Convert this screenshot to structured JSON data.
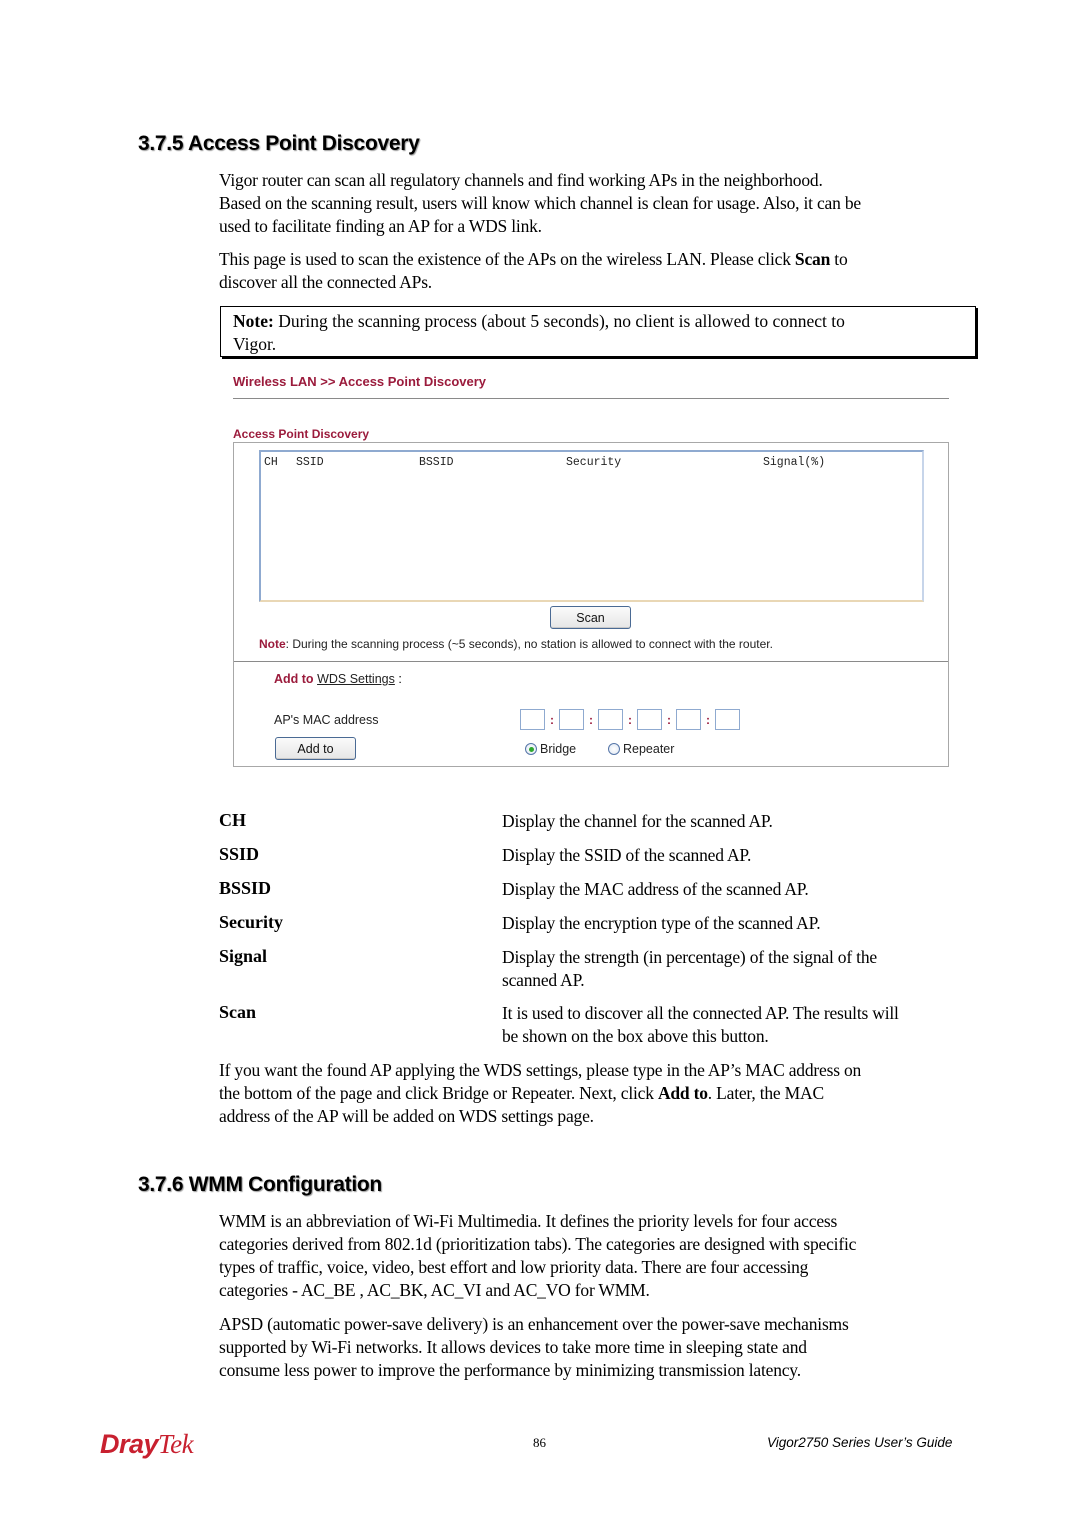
{
  "section_375": {
    "heading": "3.7.5 Access Point Discovery",
    "para1_lines": [
      "Vigor router can scan all regulatory channels and find working APs in the neighborhood.",
      "Based on the scanning result, users will know which channel is clean for usage. Also, it can be",
      "used to facilitate finding an AP for a WDS link."
    ],
    "para2_line1_before": "This page is used to scan the existence of the APs on the wireless LAN. Please click ",
    "para2_line1_bold": "Scan",
    "para2_line1_after": " to",
    "para2_line2": "discover all the connected APs.",
    "note_label": "Note:",
    "note_line1": " During the scanning process (about 5 seconds), no client is allowed to connect to",
    "note_line2": "Vigor."
  },
  "screenshot": {
    "breadcrumb": "Wireless LAN >> Access Point Discovery",
    "panel_title": "Access Point Discovery",
    "list_columns": [
      "CH",
      "SSID",
      "BSSID",
      "Security",
      "Signal(%)"
    ],
    "list_rows": [],
    "scan_button": "Scan",
    "note_label": "Note",
    "note_text": ": During the scanning process (~5 seconds), no station is allowed to connect with the router.",
    "add_to_label": "Add to",
    "wds_link": "WDS Settings",
    "wds_suffix": " :",
    "mac_label": "AP's MAC address",
    "mac_fields": [
      "",
      "",
      "",
      "",
      "",
      ""
    ],
    "mac_separator": ":",
    "add_to_button": "Add to",
    "mode_options": [
      {
        "label": "Bridge",
        "selected": true
      },
      {
        "label": "Repeater",
        "selected": false
      }
    ]
  },
  "definitions": [
    {
      "term": "CH",
      "lines": [
        "Display the channel for the scanned AP."
      ]
    },
    {
      "term": "SSID",
      "lines": [
        "Display the SSID of the scanned AP."
      ]
    },
    {
      "term": "BSSID",
      "lines": [
        "Display the MAC address of the scanned AP."
      ]
    },
    {
      "term": "Security",
      "lines": [
        "Display the encryption type of the scanned AP."
      ]
    },
    {
      "term": "Signal",
      "lines": [
        "Display the strength (in percentage) of the signal of the",
        "scanned AP."
      ]
    },
    {
      "term": "Scan",
      "lines": [
        "It is used to discover all the connected AP. The results will",
        "be shown on the box above this button."
      ]
    }
  ],
  "wds_paragraph": {
    "line1": "If you want the found AP applying the WDS settings, please type in the AP’s MAC address on",
    "line2_before": "the bottom of the page and click Bridge or Repeater. Next, click ",
    "line2_bold": "Add to",
    "line2_after": ". Later, the MAC",
    "line3": "address of the AP will be added on WDS settings page."
  },
  "section_376": {
    "heading": "3.7.6 WMM Configuration",
    "para1_lines": [
      "WMM is an abbreviation of Wi-Fi Multimedia. It defines the priority levels for four access",
      "categories derived from 802.1d (prioritization tabs). The categories are designed with specific",
      "types of traffic, voice, video, best effort and low priority data. There are four accessing",
      "categories - AC_BE , AC_BK, AC_VI and AC_VO for WMM."
    ],
    "para2_lines": [
      "APSD (automatic power-save delivery) is an enhancement over the power-save mechanisms",
      "supported by Wi-Fi networks. It allows devices to take more time in sleeping state and",
      "consume less power to improve the performance by minimizing transmission latency."
    ]
  },
  "footer": {
    "logo_dray": "Dray",
    "logo_tek": "Tek",
    "page_number": "86",
    "guide_title": "Vigor2750 Series User’s Guide"
  },
  "colors": {
    "accent_maroon": "#9b1b3c",
    "logo_red": "#c8202f",
    "radio_selected": "#2fa82f"
  }
}
